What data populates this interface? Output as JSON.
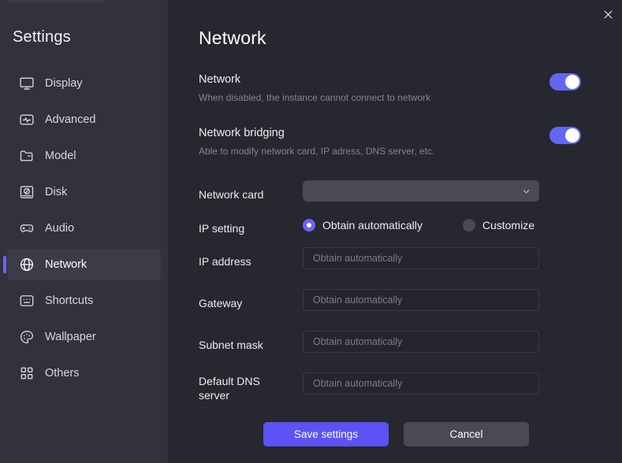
{
  "sidebar": {
    "title": "Settings",
    "items": [
      {
        "label": "Display",
        "icon": "monitor-icon",
        "selected": false
      },
      {
        "label": "Advanced",
        "icon": "activity-icon",
        "selected": false
      },
      {
        "label": "Model",
        "icon": "folder-icon",
        "selected": false
      },
      {
        "label": "Disk",
        "icon": "disk-icon",
        "selected": false
      },
      {
        "label": "Audio",
        "icon": "gamepad-icon",
        "selected": false
      },
      {
        "label": "Network",
        "icon": "globe-icon",
        "selected": true
      },
      {
        "label": "Shortcuts",
        "icon": "keyboard-icon",
        "selected": false
      },
      {
        "label": "Wallpaper",
        "icon": "palette-icon",
        "selected": false
      },
      {
        "label": "Others",
        "icon": "grid-icon",
        "selected": false
      }
    ]
  },
  "content": {
    "page_title": "Network",
    "close_icon": "close-icon",
    "network_toggle": {
      "title": "Network",
      "description": "When disabled, the instance cannot connect to network",
      "enabled": true
    },
    "bridging_toggle": {
      "title": "Network bridging",
      "description": "Able to modify network card, IP adress, DNS server, etc.",
      "enabled": true
    },
    "network_card": {
      "label": "Network card",
      "value": "",
      "chevron_icon": "chevron-down-icon"
    },
    "ip_setting": {
      "label": "IP setting",
      "options": [
        {
          "label": "Obtain automatically",
          "selected": true
        },
        {
          "label": "Customize",
          "selected": false
        }
      ]
    },
    "fields": [
      {
        "label": "IP address",
        "value": "",
        "placeholder": "Obtain automatically"
      },
      {
        "label": "Gateway",
        "value": "",
        "placeholder": "Obtain automatically"
      },
      {
        "label": "Subnet mask",
        "value": "",
        "placeholder": "Obtain automatically"
      },
      {
        "label": "Default DNS\nserver",
        "value": "",
        "placeholder": "Obtain automatically"
      }
    ],
    "dns_label_line1": "Default DNS",
    "dns_label_line2": "server",
    "buttons": {
      "save": "Save settings",
      "cancel": "Cancel"
    }
  },
  "colors": {
    "accent": "#6c63f5",
    "toggle_on": "#6366f1",
    "save_button": "#5b53f5",
    "cancel_button": "#4a4a55",
    "sidebar_bg": "#32323c",
    "content_bg": "#27272f",
    "selected_item_bg": "#3c3c47"
  }
}
